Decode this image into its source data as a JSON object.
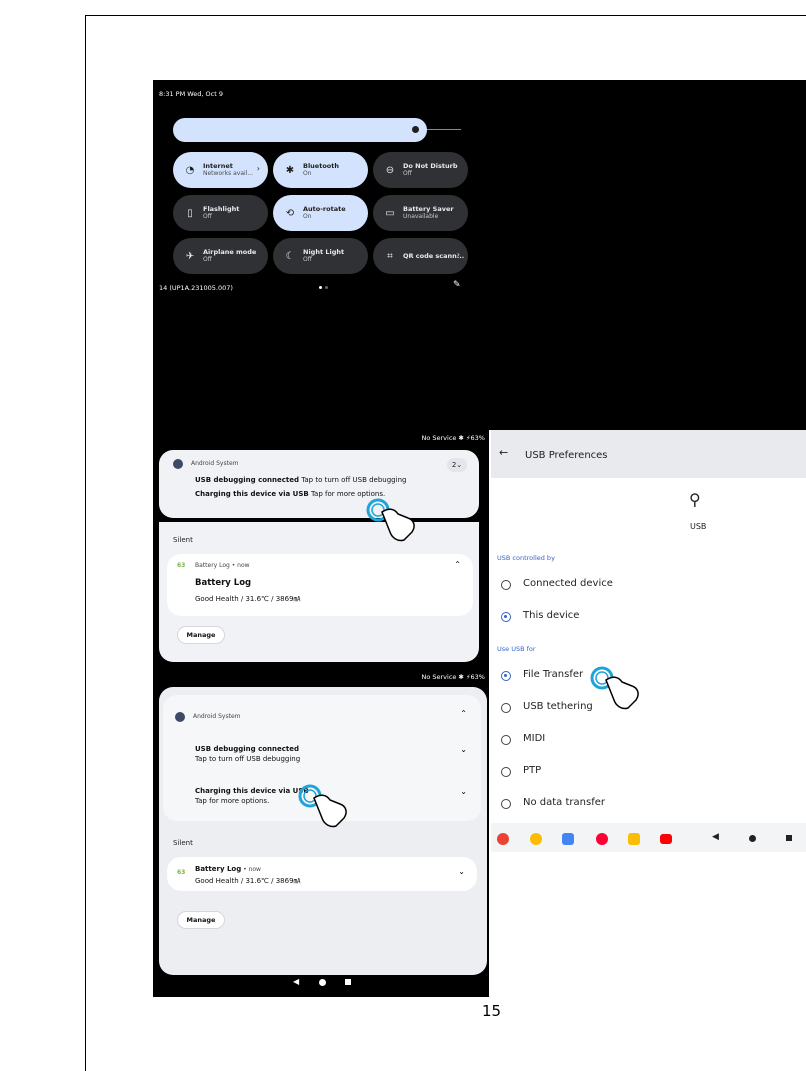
{
  "quick_settings": {
    "time_date": "8:31 PM  Wed, Oct 9",
    "tiles": [
      {
        "title": "Internet",
        "subtitle": "Networks avail...",
        "icon": "wifi-icon",
        "on": true
      },
      {
        "title": "Bluetooth",
        "subtitle": "On",
        "icon": "bluetooth-icon",
        "on": true
      },
      {
        "title": "Do Not Disturb",
        "subtitle": "Off",
        "icon": "dnd-icon",
        "on": false
      },
      {
        "title": "Flashlight",
        "subtitle": "Off",
        "icon": "flashlight-icon",
        "on": false
      },
      {
        "title": "Auto-rotate",
        "subtitle": "On",
        "icon": "rotate-icon",
        "on": true
      },
      {
        "title": "Battery Saver",
        "subtitle": "Unavailable",
        "icon": "battery-saver-icon",
        "on": false
      },
      {
        "title": "Airplane mode",
        "subtitle": "Off",
        "icon": "airplane-icon",
        "on": false
      },
      {
        "title": "Night Light",
        "subtitle": "Off",
        "icon": "night-light-icon",
        "on": false
      },
      {
        "title": "QR code scann...",
        "subtitle": "",
        "icon": "qr-icon",
        "on": false
      }
    ],
    "build": "14 (UP1A.231005.007)"
  },
  "status_bar": {
    "text": "No Service ✱ ⚡63%"
  },
  "notif1": {
    "app": "Android System",
    "count": "2",
    "line1_bold": "USB debugging connected",
    "line1_rest": " Tap to turn off USB debugging",
    "line2_bold": "Charging this device via USB",
    "line2_rest": " Tap for more options.",
    "silent": "Silent",
    "battery_app": "Battery Log • now",
    "battery_badge": "63",
    "battery_title": "Battery Log",
    "battery_text": "Good Health / 31.6℃ / 3869㎃",
    "manage": "Manage"
  },
  "notif2": {
    "app": "Android System",
    "usb_title": "USB debugging connected",
    "usb_sub": "Tap to turn off USB debugging",
    "charge_title": "Charging this device via USB",
    "charge_sub": "Tap for more options.",
    "silent": "Silent",
    "battery_title": "Battery Log",
    "battery_time": " • now",
    "battery_badge": "63",
    "battery_text": "Good Health / 31.6℃ / 3869㎃",
    "manage": "Manage"
  },
  "usb_prefs": {
    "title": "USB Preferences",
    "usb_label": "USB",
    "controlled_by": "USB controlled by",
    "controlled_options": [
      "Connected device",
      "This device"
    ],
    "controlled_selected": 1,
    "use_for": "Use USB for",
    "use_options": [
      "File Transfer",
      "USB tethering",
      "MIDI",
      "PTP",
      "No data transfer"
    ],
    "use_selected": 0
  },
  "page_number": "15",
  "colors": {
    "accent": "#3a63c5",
    "tile_on": "#d3e3fd",
    "tile_off": "#303134",
    "tap_ring": "#1fa3d8"
  }
}
